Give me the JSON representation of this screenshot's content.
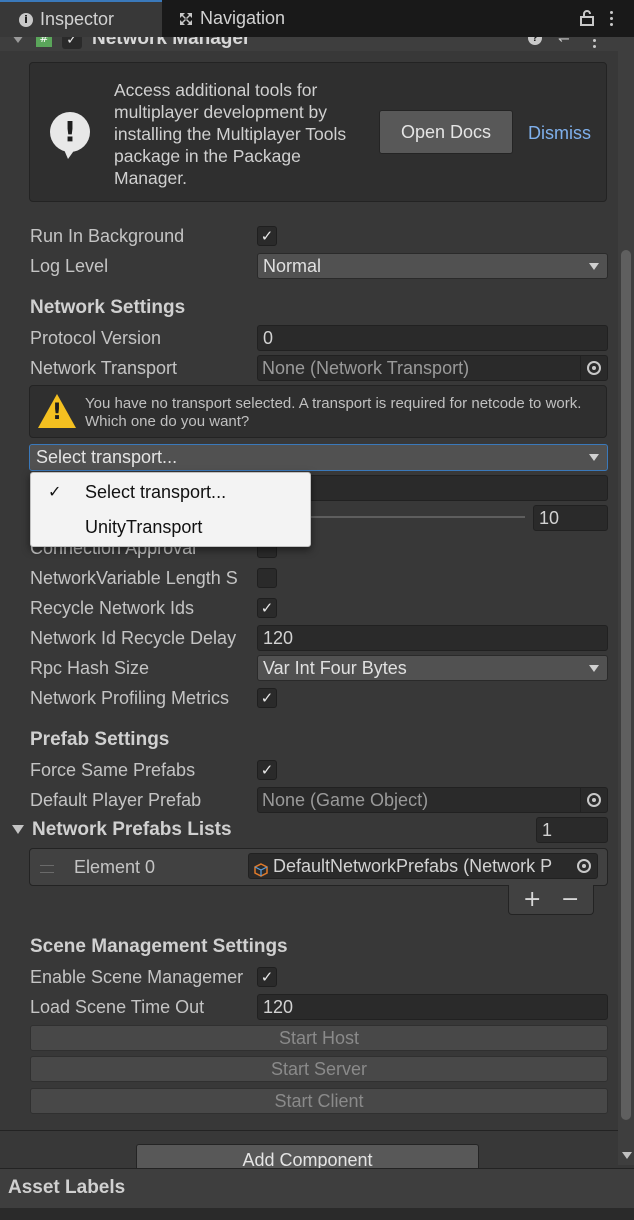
{
  "tabs": {
    "inspector": "Inspector",
    "navigation": "Navigation"
  },
  "component": {
    "title": "Network Manager"
  },
  "helpbox": {
    "text": "Access additional tools for multiplayer development by installing the Multiplayer Tools package in the Package Manager.",
    "open_docs": "Open Docs",
    "dismiss": "Dismiss"
  },
  "fields": {
    "run_in_background": "Run In Background",
    "log_level": "Log Level",
    "log_level_value": "Normal",
    "network_settings": "Network Settings",
    "protocol_version": "Protocol Version",
    "protocol_version_value": "0",
    "network_transport": "Network Transport",
    "network_transport_value": "None (Network Transport)",
    "warning": "You have no transport selected. A transport is required for netcode to work. Which one do you want?",
    "select_transport": "Select transport...",
    "slider_value": "10",
    "connection_approval": "Connection Approval",
    "netvar_length": "NetworkVariable Length S",
    "recycle_ids": "Recycle Network Ids",
    "recycle_delay": "Network Id Recycle Delay",
    "recycle_delay_value": "120",
    "rpc_hash": "Rpc Hash Size",
    "rpc_hash_value": "Var Int Four Bytes",
    "profiling": "Network Profiling Metrics",
    "prefab_settings": "Prefab Settings",
    "force_same": "Force Same Prefabs",
    "default_player": "Default Player Prefab",
    "default_player_value": "None (Game Object)",
    "prefab_lists": "Network Prefabs Lists",
    "prefab_lists_count": "1",
    "element0": "Element 0",
    "element0_value": "DefaultNetworkPrefabs (Network P",
    "scene_mgmt": "Scene Management Settings",
    "enable_scene": "Enable Scene Managemer",
    "load_timeout": "Load Scene Time Out",
    "load_timeout_value": "120",
    "start_host": "Start Host",
    "start_server": "Start Server",
    "start_client": "Start Client"
  },
  "popup": {
    "items": [
      "Select transport...",
      "UnityTransport"
    ],
    "selected": "Select transport..."
  },
  "checks": {
    "run_in_background": true,
    "connection_approval": false,
    "netvar_length": false,
    "recycle_ids": true,
    "profiling": true,
    "force_same": true,
    "enable_scene": true
  },
  "add_component": "Add Component",
  "asset_labels": "Asset Labels",
  "colors": {
    "accent": "#3a79bb",
    "warning": "#f4c020",
    "link": "#7fb0ec"
  }
}
